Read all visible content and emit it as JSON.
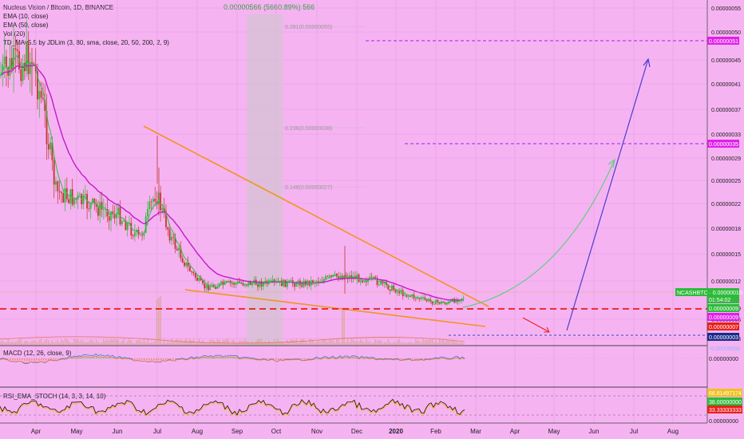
{
  "window": {
    "title": "Nucleus Vision / Bitcoin, 1D, BINANCE",
    "change_text": "0.00000566 (5660.89%) 566"
  },
  "indicators": [
    "EMA (10, close)",
    "EMA (50, close)",
    "Vol (20)",
    "TD_MAv5.5 by JDLim (3, 80, sma, close, 20, 50, 200, 2, 9)"
  ],
  "macd_label": "MACD (12, 26, close, 9)",
  "rsi_label": "RSI_EMA_STOCH (14, 3, 3, 14, 10)",
  "colors": {
    "background": "#f6b3f2",
    "up": "#2dbb3a",
    "down": "#c0392b",
    "ema10": "#29c23c",
    "ema50": "#c21bc9",
    "trendline": "#f0961e",
    "support": "#e8201a",
    "target_line": "#a020f0",
    "projection_curve": "#5ecf82",
    "projection_arrow": "#4a3fcf"
  },
  "chart_data": [
    {
      "type": "candlestick",
      "title": "Nucleus Vision / Bitcoin, 1D, BINANCE",
      "x_months": [
        "Apr",
        "May",
        "Jun",
        "Jul",
        "Aug",
        "Sep",
        "Oct",
        "Nov",
        "Dec",
        "2020",
        "Feb",
        "Mar",
        "Apr",
        "May",
        "Jun",
        "Jul",
        "Aug"
      ],
      "y_ticks": [
        "0.00000055",
        "0.00000050",
        "0.00000045",
        "0.00000041",
        "0.00000037",
        "0.00000033",
        "0.00000029",
        "0.00000025",
        "0.00000022",
        "0.00000018",
        "0.00000015",
        "0.00000012",
        "0.00000009",
        "0.00000006",
        "0.00000003"
      ],
      "close_by_month": [
        {
          "month": "Apr",
          "close": 4.6e-07
        },
        {
          "month": "May",
          "close": 2.8e-07
        },
        {
          "month": "Jun",
          "close": 2.4e-07
        },
        {
          "month": "Jul",
          "close": 2e-07
        },
        {
          "month": "Aug",
          "close": 1.15e-07
        },
        {
          "month": "Sep",
          "close": 1.2e-07
        },
        {
          "month": "Oct",
          "close": 1.2e-07
        },
        {
          "month": "Nov",
          "close": 1.2e-07
        },
        {
          "month": "Dec",
          "close": 1.25e-07
        },
        {
          "month": "2020",
          "close": 1.05e-07
        },
        {
          "month": "Feb",
          "close": 1e-07
        }
      ],
      "fibonacci_levels": [
        {
          "label": "0.281(0.00000055)",
          "value": 5.5e-07
        },
        {
          "label": "0.236(0.00000038)",
          "value": 3.8e-07
        },
        {
          "label": "0.148(0.00000027)",
          "value": 2.7e-07
        }
      ],
      "horizontal_levels": [
        {
          "label": "0.00000051",
          "value": 5.1e-07,
          "color": "#a020f0",
          "style": "dashed"
        },
        {
          "label": "0.00000035",
          "value": 3.5e-07,
          "color": "#a020f0",
          "style": "dashed"
        },
        {
          "label": "0.00000009",
          "value": 9e-08,
          "color": "#e8201a",
          "style": "dashed"
        },
        {
          "label": "0.00000003",
          "value": 3e-08,
          "color": "#3344bb",
          "style": "dashed"
        }
      ],
      "price_tags": [
        {
          "label": "NCASHBTC",
          "value": "0.00000010",
          "bg": "#2dbb3a"
        },
        {
          "label": "",
          "value": "01:54:02",
          "bg": "#2dbb3a"
        },
        {
          "label": "",
          "value": "0.00000009",
          "bg": "#2dbb3a"
        },
        {
          "label": "",
          "value": "0.00000009",
          "bg": "#e020e8"
        },
        {
          "label": "",
          "value": "0.00000007",
          "bg": "#e8201a"
        },
        {
          "label": "",
          "value": "0.00000003",
          "bg": "#1a2a8a"
        }
      ],
      "other_labels": [
        "0.00000009",
        "-0.00000000",
        "0.00000000"
      ],
      "rsi_ticks": [
        "66.81497174",
        "38.00000000",
        "33.33333333",
        "0.00000000"
      ]
    }
  ]
}
